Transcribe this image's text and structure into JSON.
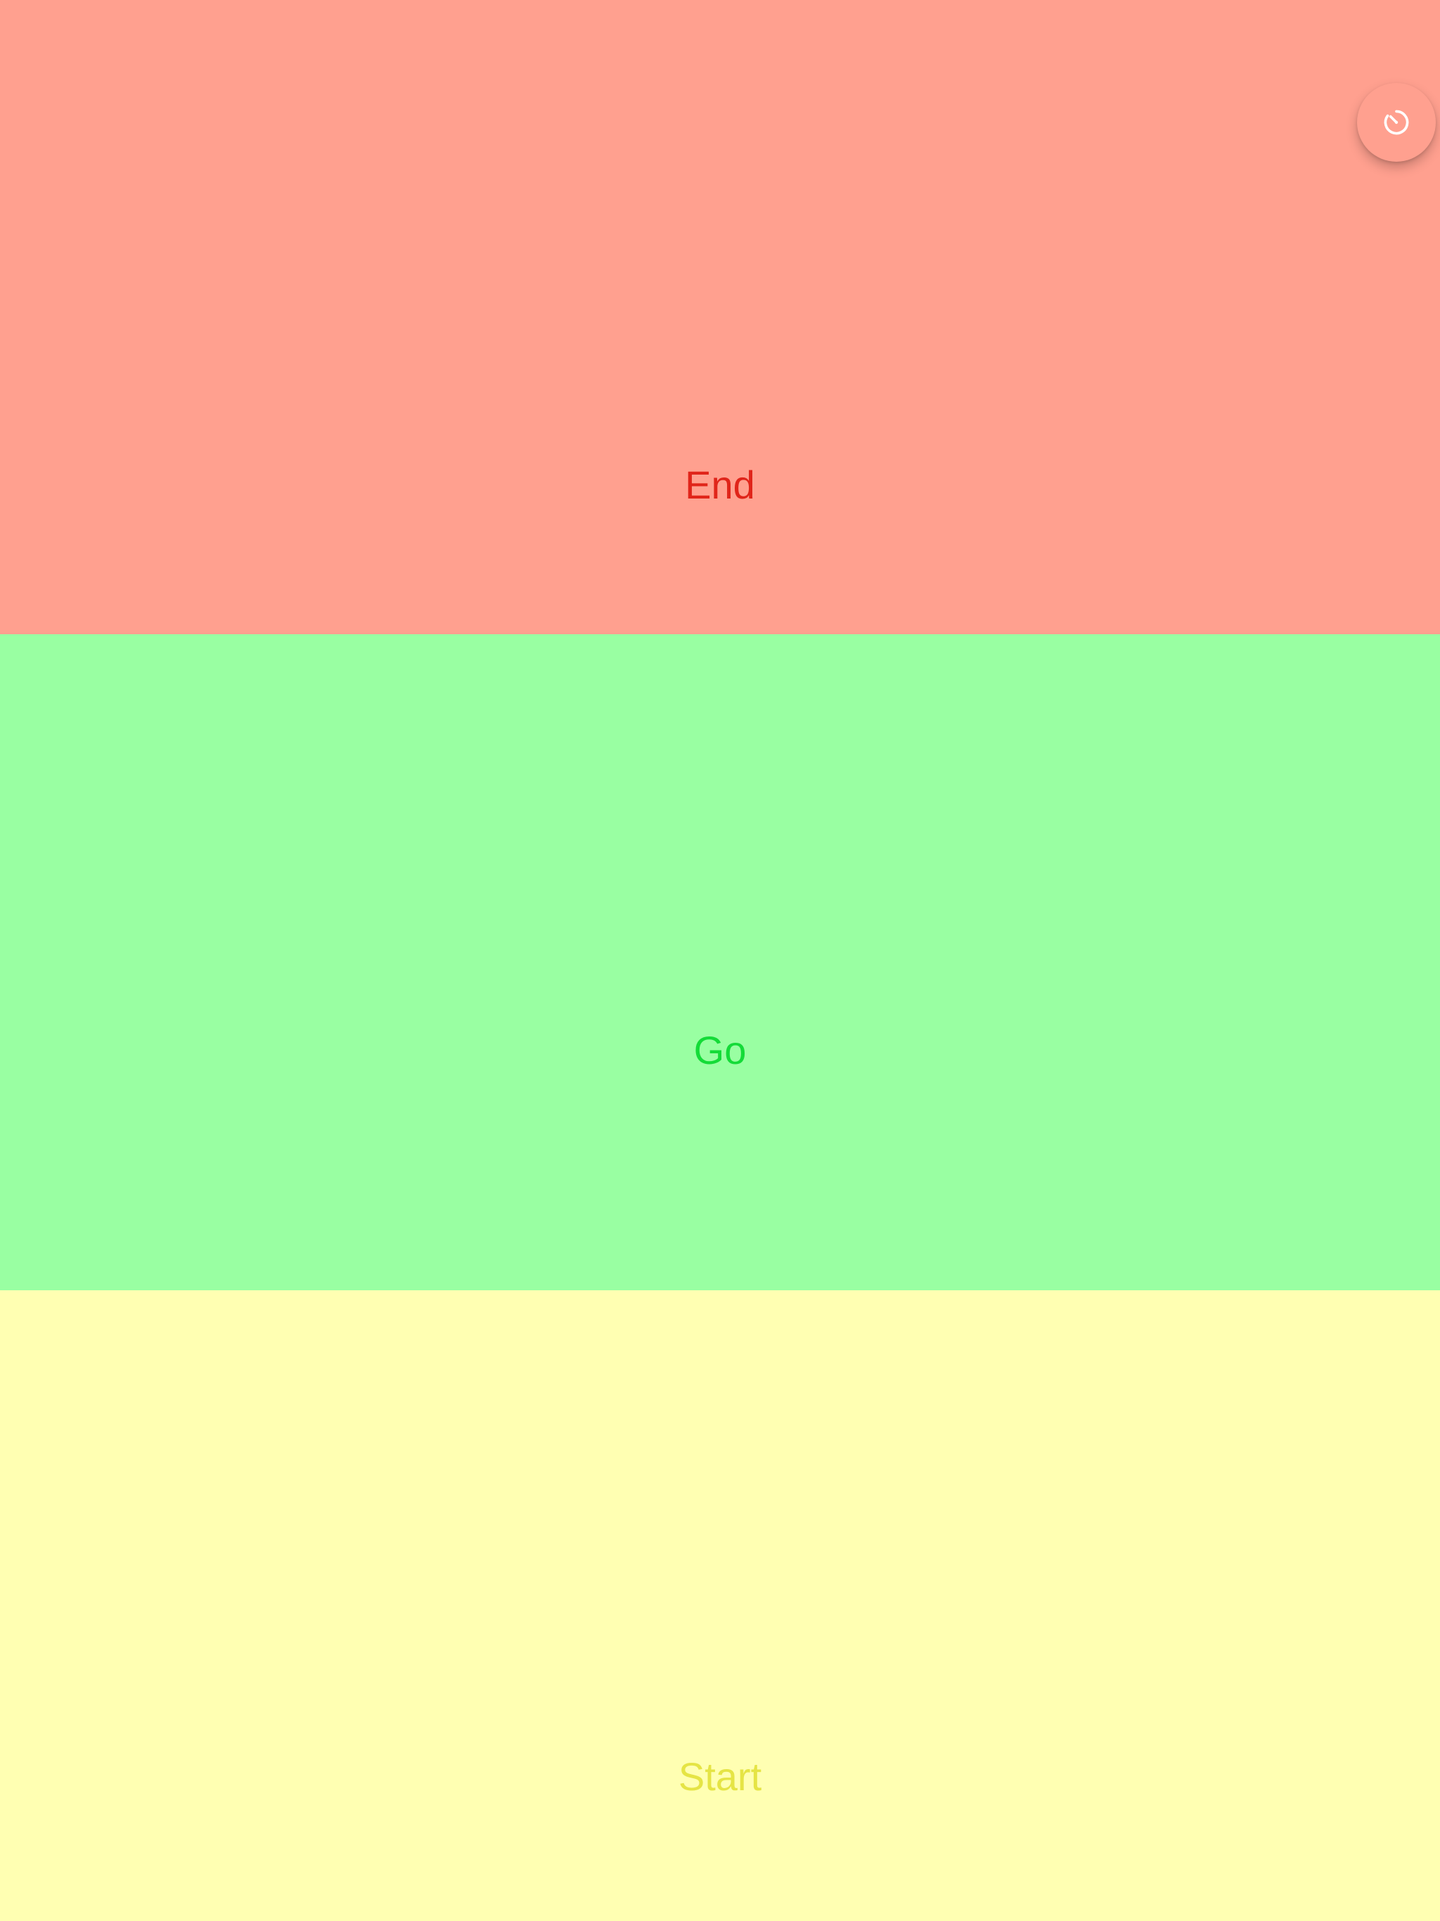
{
  "panels": {
    "end": {
      "label": "End",
      "color": "#ffa08f",
      "text_color": "#e0251a"
    },
    "go": {
      "label": "Go",
      "color": "#99ffa2",
      "text_color": "#14db38"
    },
    "start": {
      "label": "Start",
      "color": "#ffffb2",
      "text_color": "#e5e445"
    }
  },
  "timer_button": {
    "icon": "timer-icon"
  }
}
